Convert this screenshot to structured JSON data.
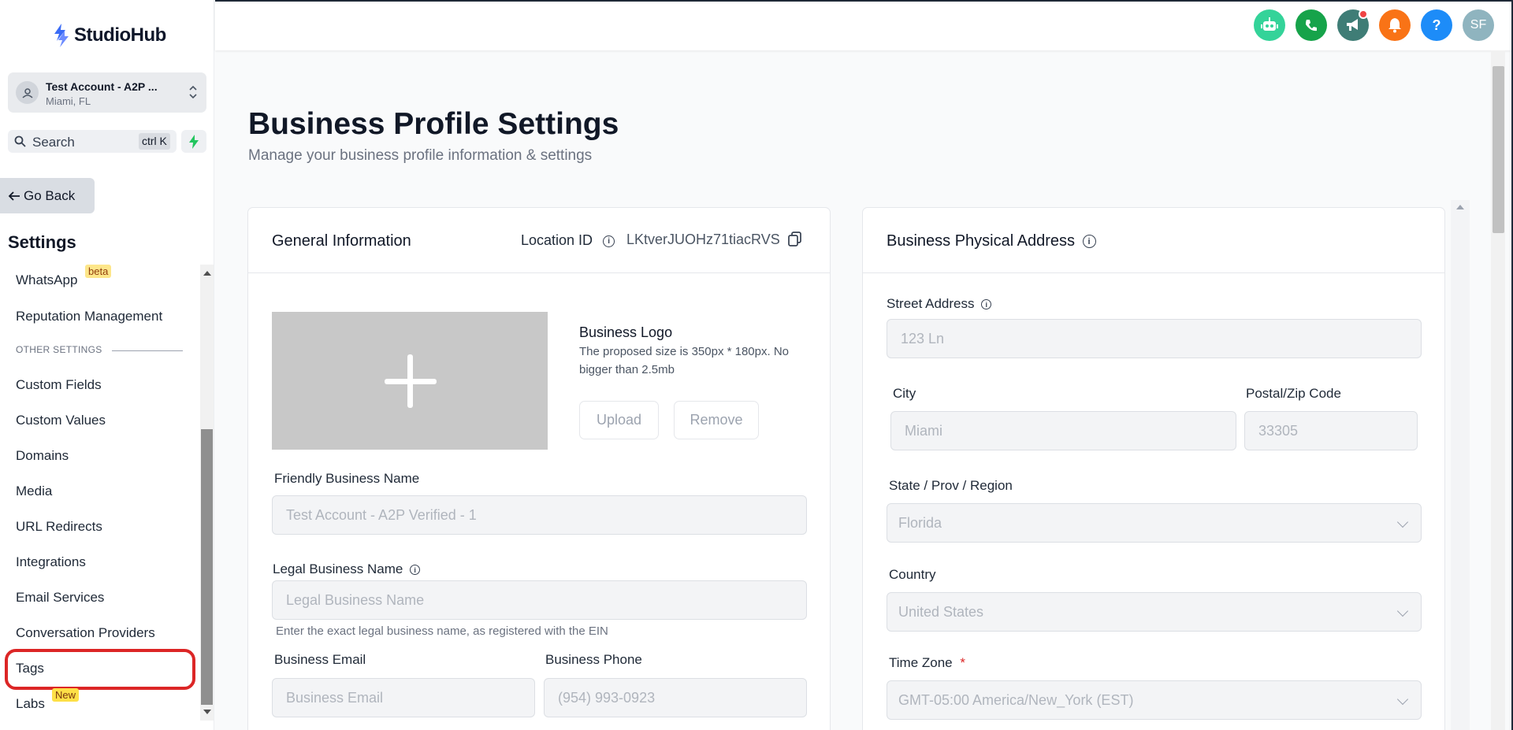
{
  "brand": {
    "name": "StudioHub",
    "accent": "#3b6cf6"
  },
  "account": {
    "name": "Test Account - A2P ...",
    "location": "Miami, FL"
  },
  "search": {
    "label": "Search",
    "shortcut": "ctrl K"
  },
  "nav": {
    "go_back": "Go Back",
    "settings_title": "Settings"
  },
  "menu": {
    "whatsapp": "WhatsApp",
    "whatsapp_badge": "beta",
    "reputation": "Reputation Management",
    "section_other": "OTHER SETTINGS",
    "custom_fields": "Custom Fields",
    "custom_values": "Custom Values",
    "domains": "Domains",
    "media": "Media",
    "url_redirects": "URL Redirects",
    "integrations": "Integrations",
    "email_services": "Email Services",
    "conversation_providers": "Conversation Providers",
    "tags": "Tags",
    "labs": "Labs",
    "labs_badge": "New"
  },
  "topbar": {
    "avatar_initials": "SF",
    "help_glyph": "?",
    "icons": [
      "robot-icon",
      "phone-icon",
      "megaphone-icon",
      "bell-icon",
      "help-icon"
    ]
  },
  "page": {
    "title": "Business Profile Settings",
    "subtitle": "Manage your business profile information & settings"
  },
  "general": {
    "title": "General Information",
    "location_id_label": "Location ID",
    "location_id": "LKtverJUOHz71tiacRVS",
    "logo_label": "Business Logo",
    "logo_hint": "The proposed size is 350px * 180px. No bigger than 2.5mb",
    "upload": "Upload",
    "remove": "Remove",
    "friendly_name_label": "Friendly Business Name",
    "friendly_name_placeholder": "Test Account - A2P Verified - 1",
    "legal_name_label": "Legal Business Name",
    "legal_name_placeholder": "Legal Business Name",
    "legal_name_help": "Enter the exact legal business name, as registered with the EIN",
    "email_label": "Business Email",
    "email_placeholder": "Business Email",
    "phone_label": "Business Phone",
    "phone_placeholder": "(954) 993-0923"
  },
  "address": {
    "title": "Business Physical Address",
    "street_label": "Street Address",
    "street_placeholder": "123 Ln",
    "city_label": "City",
    "city_placeholder": "Miami",
    "zip_label": "Postal/Zip Code",
    "zip_placeholder": "33305",
    "state_label": "State / Prov / Region",
    "state_value": "Florida",
    "country_label": "Country",
    "country_value": "United States",
    "timezone_label": "Time Zone",
    "timezone_required": "*",
    "timezone_value": "GMT-05:00 America/New_York (EST)"
  }
}
